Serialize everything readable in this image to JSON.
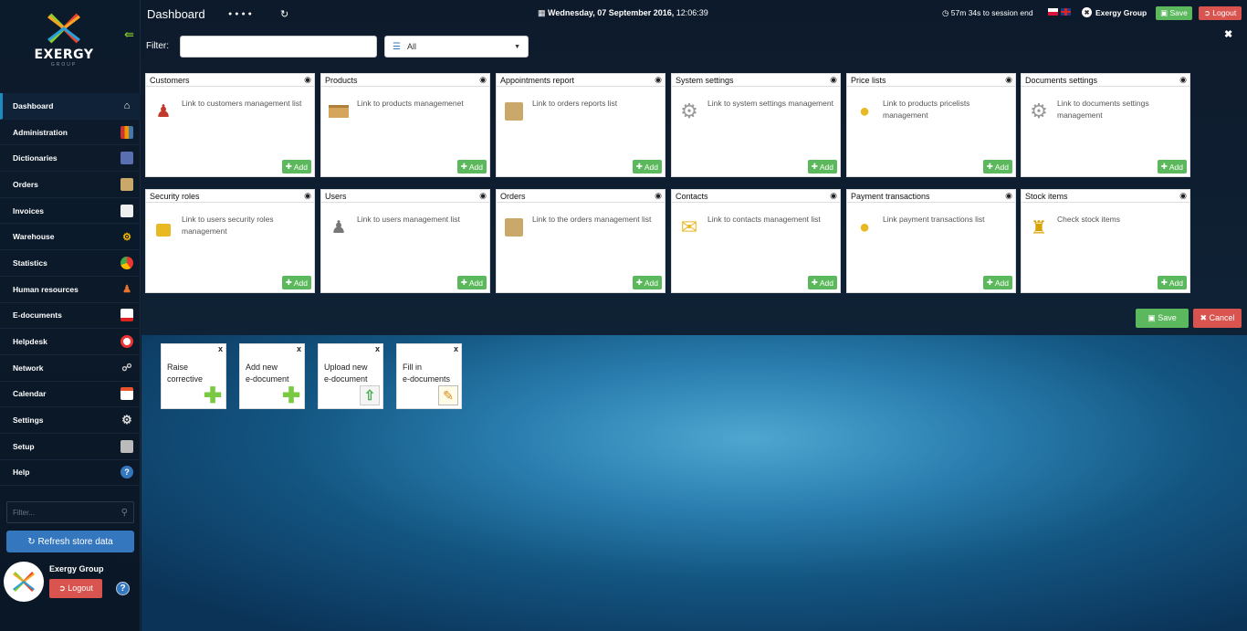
{
  "brand": {
    "name": "EXERGY",
    "sub": "GROUP"
  },
  "sidebar": {
    "items": [
      {
        "label": "Dashboard",
        "icon": "home-icon"
      },
      {
        "label": "Administration",
        "icon": "books-icon"
      },
      {
        "label": "Dictionaries",
        "icon": "book-icon"
      },
      {
        "label": "Orders",
        "icon": "box-icon"
      },
      {
        "label": "Invoices",
        "icon": "document-icon"
      },
      {
        "label": "Warehouse",
        "icon": "forklift-icon"
      },
      {
        "label": "Statistics",
        "icon": "pie-chart-icon"
      },
      {
        "label": "Human resources",
        "icon": "person-icon"
      },
      {
        "label": "E-documents",
        "icon": "pdf-icon"
      },
      {
        "label": "Helpdesk",
        "icon": "lifebuoy-icon"
      },
      {
        "label": "Network",
        "icon": "network-icon"
      },
      {
        "label": "Calendar",
        "icon": "calendar-icon"
      },
      {
        "label": "Settings",
        "icon": "gear-icon"
      },
      {
        "label": "Setup",
        "icon": "setup-icon"
      },
      {
        "label": "Help",
        "icon": "help-icon"
      }
    ],
    "filter_placeholder": "Filter...",
    "refresh_label": "Refresh store data",
    "user_name": "Exergy Group",
    "logout_label": "Logout",
    "help_label": "?"
  },
  "header": {
    "title": "Dashboard",
    "datetime_date": "Wednesday, 07 September 2016,",
    "datetime_time": "12:06:39",
    "session": "57m 34s to session end",
    "company": "Exergy Group",
    "save_label": "Save",
    "logout_label": "Logout"
  },
  "filter": {
    "label": "Filter:",
    "value": "",
    "select_value": "All"
  },
  "tiles": [
    {
      "title": "Customers",
      "link": "Link to customers management list",
      "add": "Add",
      "icon": "customer-icon"
    },
    {
      "title": "Products",
      "link": "Link to products managemenet",
      "add": "Add",
      "icon": "open-box-icon"
    },
    {
      "title": "Appointments report",
      "link": "Link to orders reports list",
      "add": "Add",
      "icon": "box-icon"
    },
    {
      "title": "System settings",
      "link": "Link to system settings management",
      "add": "Add",
      "icon": "gear-icon"
    },
    {
      "title": "Price lists",
      "link": "Link to products pricelists management",
      "add": "Add",
      "icon": "coins-icon"
    },
    {
      "title": "Documents settings",
      "link": "Link to documents settings management",
      "add": "Add",
      "icon": "gear-icon"
    },
    {
      "title": "Security roles",
      "link": "Link to users security roles management",
      "add": "Add",
      "icon": "lock-icon"
    },
    {
      "title": "Users",
      "link": "Link to users management list",
      "add": "Add",
      "icon": "user-icon"
    },
    {
      "title": "Orders",
      "link": "Link to the orders management list",
      "add": "Add",
      "icon": "box-icon"
    },
    {
      "title": "Contacts",
      "link": "Link to contacts management list",
      "add": "Add",
      "icon": "envelope-icon"
    },
    {
      "title": "Payment transactions",
      "link": "Link payment transactions list",
      "add": "Add",
      "icon": "coins-icon"
    },
    {
      "title": "Stock items",
      "link": "Check stock items",
      "add": "Add",
      "icon": "forklift-icon"
    }
  ],
  "actions": {
    "save_label": "Save",
    "cancel_label": "Cancel"
  },
  "quick_tiles": [
    {
      "label_line1": "Raise",
      "label_line2": "corrective",
      "icon": "plus-icon",
      "close": "x"
    },
    {
      "label_line1": "Add new",
      "label_line2": "e-document",
      "icon": "plus-icon",
      "close": "x"
    },
    {
      "label_line1": "Upload new",
      "label_line2": "e-document",
      "icon": "upload-icon",
      "close": "x"
    },
    {
      "label_line1": "Fill in",
      "label_line2": "e-documents",
      "icon": "form-edit-icon",
      "close": "x"
    }
  ],
  "colors": {
    "sidebar_bg": "#0c1b2c",
    "success": "#5cb85c",
    "danger": "#d9534f",
    "primary": "#3577be",
    "active_border": "#1f8ac0",
    "logo_green": "#8ccf2a"
  }
}
